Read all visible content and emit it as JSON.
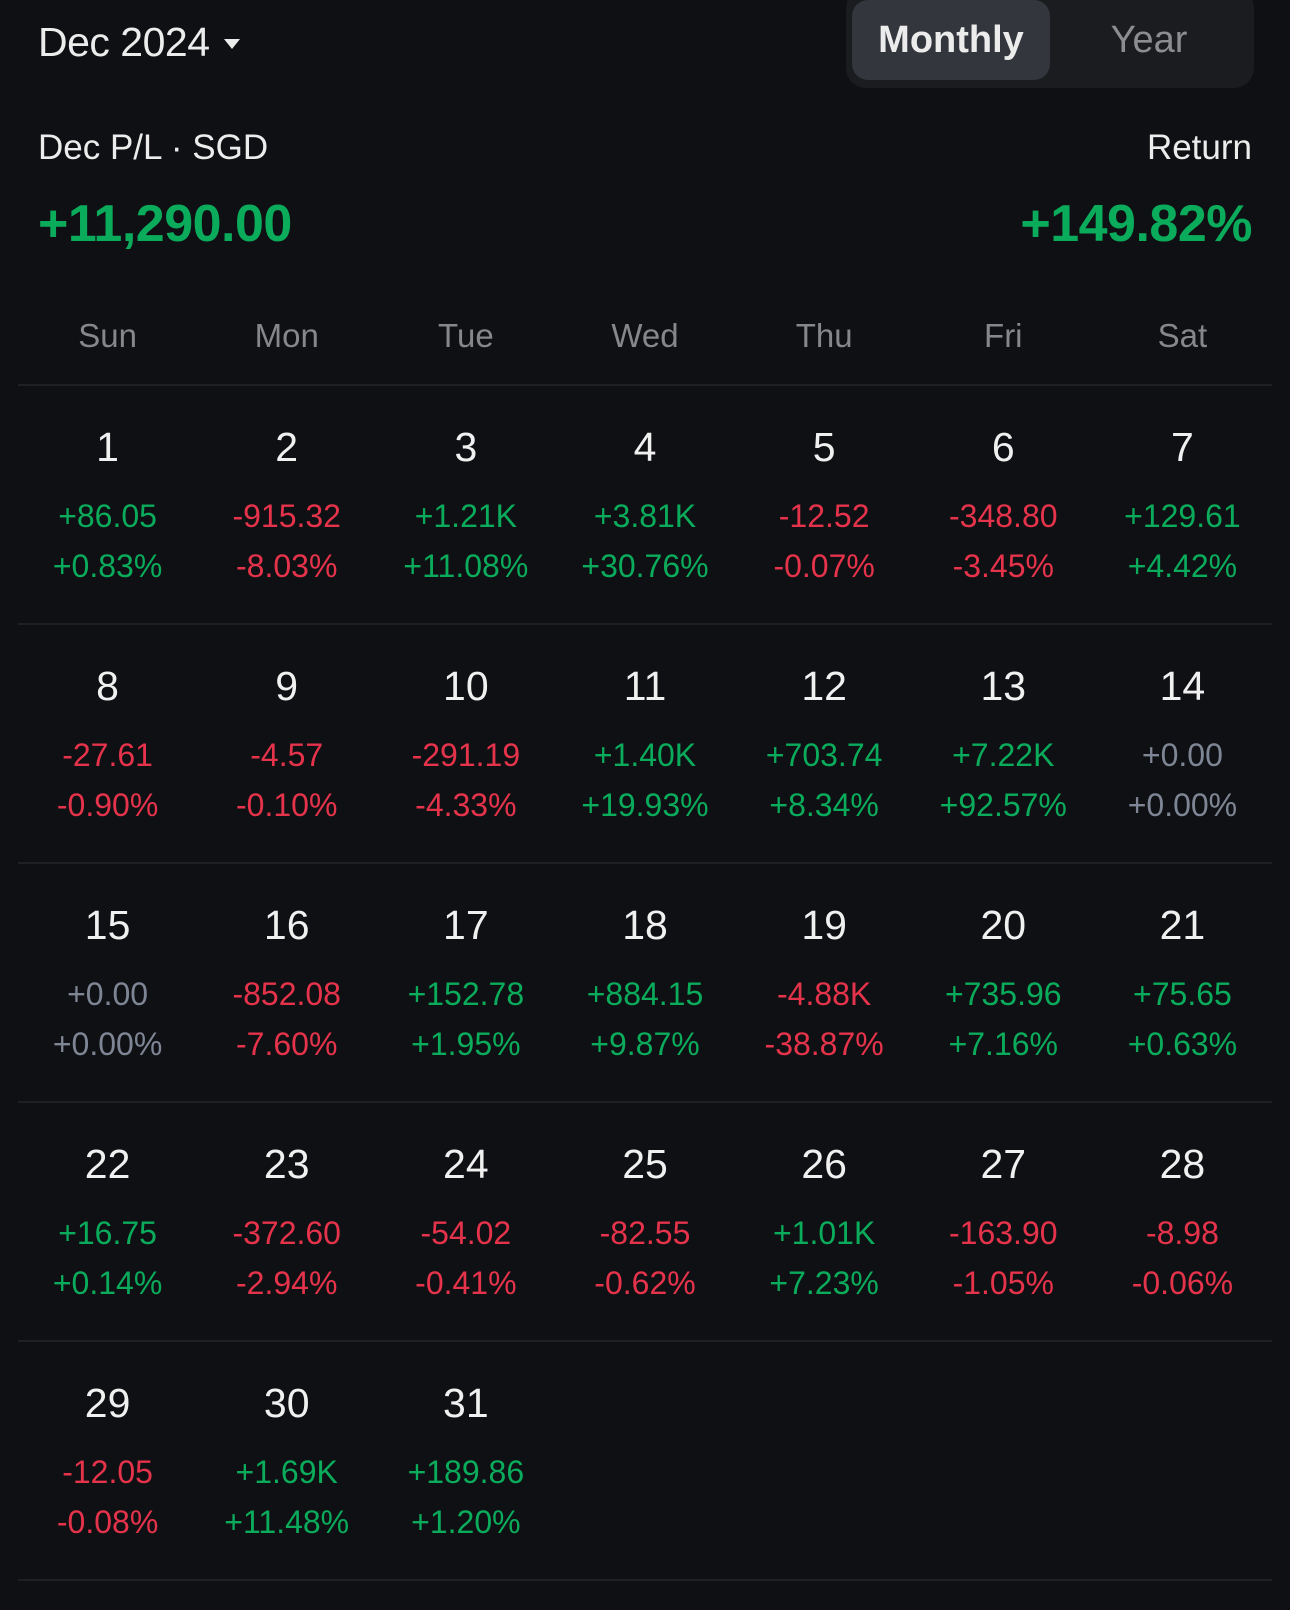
{
  "header": {
    "month_label": "Dec 2024",
    "toggle": [
      {
        "label": "Monthly",
        "active": true
      },
      {
        "label": "Year",
        "active": false
      }
    ]
  },
  "summary": {
    "pl_label": "Dec P/L · SGD",
    "pl_value": "+11,290.00",
    "return_label": "Return",
    "return_value": "+149.82%"
  },
  "colors": {
    "positive": "#0bab5c",
    "negative": "#e5334b",
    "neutral": "#7e8594",
    "background": "#0f1013"
  },
  "weekdays": [
    "Sun",
    "Mon",
    "Tue",
    "Wed",
    "Thu",
    "Fri",
    "Sat"
  ],
  "weeks": [
    [
      {
        "day": "1",
        "value": "+86.05",
        "pct": "+0.83%",
        "trend": "pos"
      },
      {
        "day": "2",
        "value": "-915.32",
        "pct": "-8.03%",
        "trend": "neg"
      },
      {
        "day": "3",
        "value": "+1.21K",
        "pct": "+11.08%",
        "trend": "pos"
      },
      {
        "day": "4",
        "value": "+3.81K",
        "pct": "+30.76%",
        "trend": "pos"
      },
      {
        "day": "5",
        "value": "-12.52",
        "pct": "-0.07%",
        "trend": "neg"
      },
      {
        "day": "6",
        "value": "-348.80",
        "pct": "-3.45%",
        "trend": "neg"
      },
      {
        "day": "7",
        "value": "+129.61",
        "pct": "+4.42%",
        "trend": "pos"
      }
    ],
    [
      {
        "day": "8",
        "value": "-27.61",
        "pct": "-0.90%",
        "trend": "neg"
      },
      {
        "day": "9",
        "value": "-4.57",
        "pct": "-0.10%",
        "trend": "neg"
      },
      {
        "day": "10",
        "value": "-291.19",
        "pct": "-4.33%",
        "trend": "neg"
      },
      {
        "day": "11",
        "value": "+1.40K",
        "pct": "+19.93%",
        "trend": "pos"
      },
      {
        "day": "12",
        "value": "+703.74",
        "pct": "+8.34%",
        "trend": "pos"
      },
      {
        "day": "13",
        "value": "+7.22K",
        "pct": "+92.57%",
        "trend": "pos"
      },
      {
        "day": "14",
        "value": "+0.00",
        "pct": "+0.00%",
        "trend": "zero"
      }
    ],
    [
      {
        "day": "15",
        "value": "+0.00",
        "pct": "+0.00%",
        "trend": "zero"
      },
      {
        "day": "16",
        "value": "-852.08",
        "pct": "-7.60%",
        "trend": "neg"
      },
      {
        "day": "17",
        "value": "+152.78",
        "pct": "+1.95%",
        "trend": "pos"
      },
      {
        "day": "18",
        "value": "+884.15",
        "pct": "+9.87%",
        "trend": "pos"
      },
      {
        "day": "19",
        "value": "-4.88K",
        "pct": "-38.87%",
        "trend": "neg"
      },
      {
        "day": "20",
        "value": "+735.96",
        "pct": "+7.16%",
        "trend": "pos"
      },
      {
        "day": "21",
        "value": "+75.65",
        "pct": "+0.63%",
        "trend": "pos"
      }
    ],
    [
      {
        "day": "22",
        "value": "+16.75",
        "pct": "+0.14%",
        "trend": "pos"
      },
      {
        "day": "23",
        "value": "-372.60",
        "pct": "-2.94%",
        "trend": "neg"
      },
      {
        "day": "24",
        "value": "-54.02",
        "pct": "-0.41%",
        "trend": "neg"
      },
      {
        "day": "25",
        "value": "-82.55",
        "pct": "-0.62%",
        "trend": "neg"
      },
      {
        "day": "26",
        "value": "+1.01K",
        "pct": "+7.23%",
        "trend": "pos"
      },
      {
        "day": "27",
        "value": "-163.90",
        "pct": "-1.05%",
        "trend": "neg"
      },
      {
        "day": "28",
        "value": "-8.98",
        "pct": "-0.06%",
        "trend": "neg"
      }
    ],
    [
      {
        "day": "29",
        "value": "-12.05",
        "pct": "-0.08%",
        "trend": "neg"
      },
      {
        "day": "30",
        "value": "+1.69K",
        "pct": "+11.48%",
        "trend": "pos"
      },
      {
        "day": "31",
        "value": "+189.86",
        "pct": "+1.20%",
        "trend": "pos"
      },
      null,
      null,
      null,
      null
    ]
  ]
}
